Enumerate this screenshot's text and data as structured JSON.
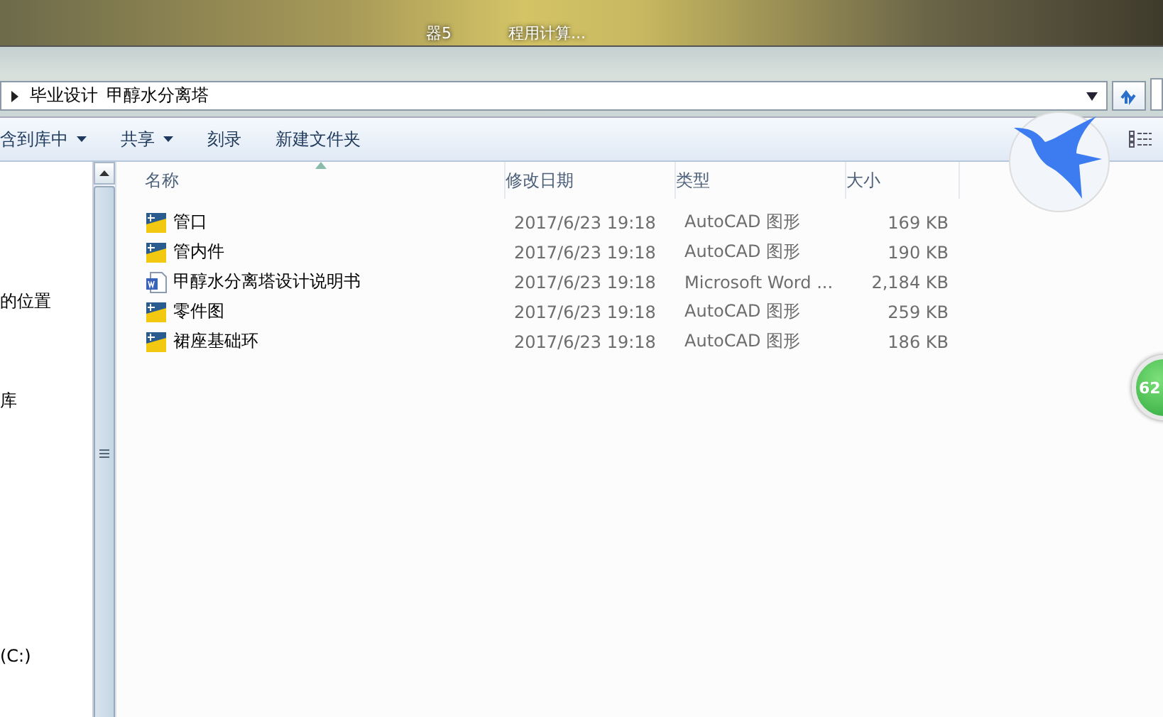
{
  "desktop": {
    "icon_labels": [
      "器5",
      "程用计算..."
    ]
  },
  "address_bar": {
    "path": [
      "毕业设计",
      "甲醇水分离塔"
    ]
  },
  "toolbar": {
    "buttons": [
      {
        "label": "含到库中",
        "kind": "menu"
      },
      {
        "label": "共享",
        "kind": "menu"
      },
      {
        "label": "刻录",
        "kind": "plain"
      },
      {
        "label": "新建文件夹",
        "kind": "plain"
      }
    ]
  },
  "navigation": {
    "items": [
      {
        "label": "的位置"
      },
      {
        "label": "库"
      },
      {
        "label": "(C:)"
      }
    ]
  },
  "table": {
    "columns": [
      "名称",
      "修改日期",
      "类型",
      "大小"
    ],
    "rows": [
      {
        "name": "管口",
        "kind": "cad",
        "date": "2017/6/23 19:18",
        "type": "AutoCAD 图形",
        "size": "169 KB"
      },
      {
        "name": "管内件",
        "kind": "cad",
        "date": "2017/6/23 19:18",
        "type": "AutoCAD 图形",
        "size": "190 KB"
      },
      {
        "name": "甲醇水分离塔设计说明书",
        "kind": "word",
        "date": "2017/6/23 19:18",
        "type": "Microsoft Word ...",
        "size": "2,184 KB"
      },
      {
        "name": "零件图",
        "kind": "cad",
        "date": "2017/6/23 19:18",
        "type": "AutoCAD 图形",
        "size": "259 KB"
      },
      {
        "name": "裙座基础环",
        "kind": "cad",
        "date": "2017/6/23 19:18",
        "type": "AutoCAD 图形",
        "size": "186 KB"
      }
    ]
  },
  "badge": {
    "text": "62"
  }
}
